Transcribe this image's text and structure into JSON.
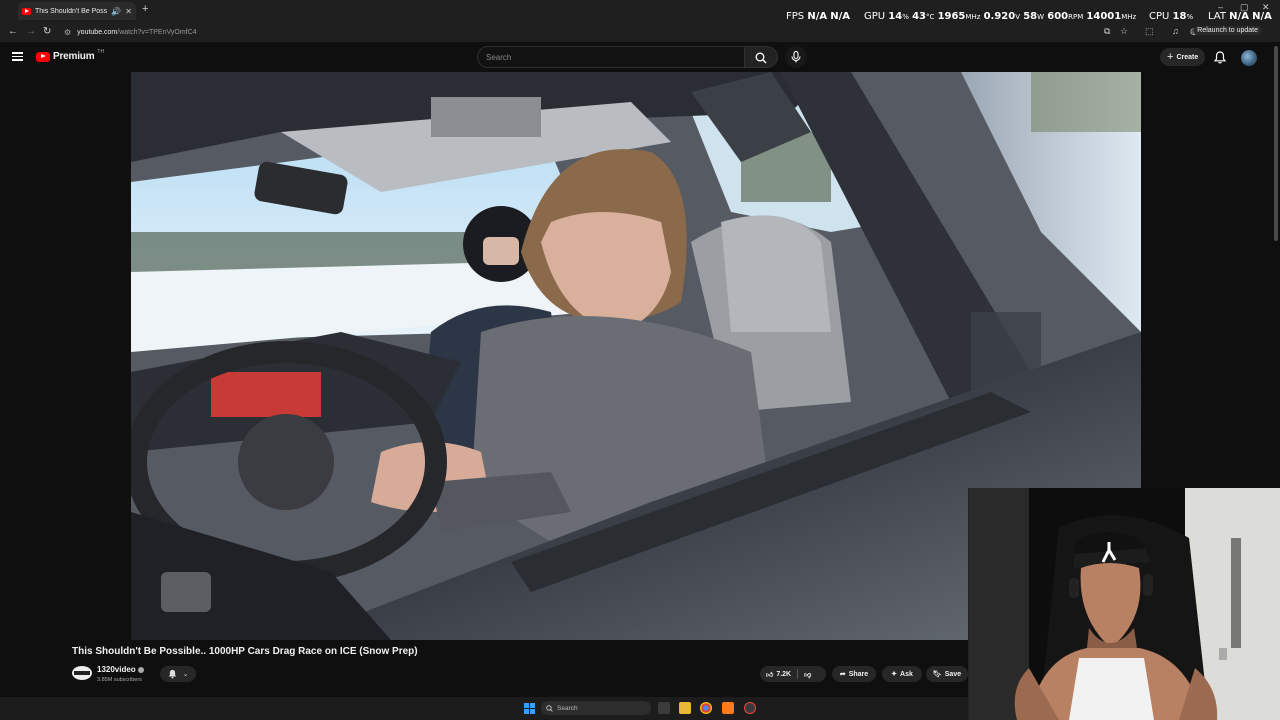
{
  "browser": {
    "tab_title": "This Shouldn't Be Possible.",
    "url_host": "youtube.com",
    "url_path": "/watch?v=TPEnVyOmfC4",
    "relaunch_label": "Relaunch to update"
  },
  "overlay": {
    "fps_label": "FPS",
    "fps_value": "N/A",
    "fps_value2": "N/A",
    "gpu_label": "GPU",
    "gpu_load": "14",
    "gpu_load_unit": "%",
    "gpu_temp": "43",
    "gpu_temp_unit": "°C",
    "gpu_clock": "1965",
    "gpu_clock_unit": "MHz",
    "gpu_voltage": "0.920",
    "gpu_voltage_unit": "V",
    "gpu_power": "58",
    "gpu_power_unit": "W",
    "gpu_fan": "600",
    "gpu_fan_unit": "RPM",
    "gpu_mem": "14001",
    "gpu_mem_unit": "MHz",
    "cpu_label": "CPU",
    "cpu_load": "18",
    "cpu_load_unit": "%",
    "lat_label": "LAT",
    "lat_value": "N/A",
    "lat_value2": "N/A"
  },
  "header": {
    "logo_word": "Premium",
    "logo_sup": "TH",
    "search_placeholder": "Search",
    "create_label": "Create"
  },
  "video": {
    "title": "This Shouldn't Be Possible.. 1000HP Cars Drag Race on ICE (Snow Prep)",
    "channel_name": "1320video",
    "subscribers": "3.85M subscribers",
    "likes": "7.2K",
    "share_label": "Share",
    "ask_label": "Ask",
    "save_label": "Save"
  },
  "taskbar": {
    "search_placeholder": "Search"
  },
  "colors": {
    "brand": "#ff0000",
    "background": "#0f0f0f",
    "pill": "#272727"
  }
}
